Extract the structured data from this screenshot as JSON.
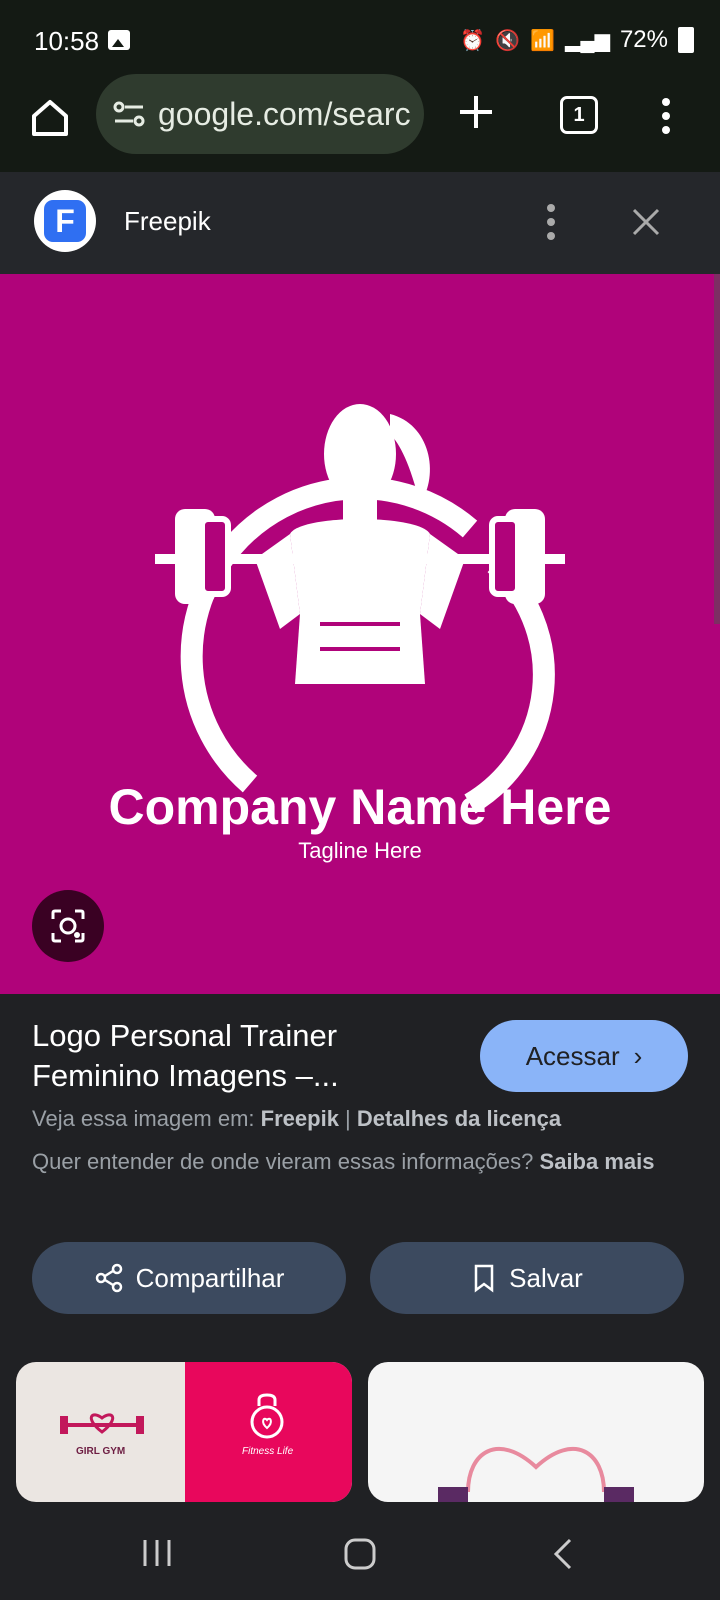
{
  "status_bar": {
    "time": "10:58",
    "battery": "72%"
  },
  "browser": {
    "url": "google.com/searc",
    "tab_count": "1"
  },
  "source": {
    "name": "Freepik",
    "logo_letter": "F"
  },
  "image": {
    "company_name": "Company Name Here",
    "tagline": "Tagline Here"
  },
  "result": {
    "title": "Logo Personal Trainer Feminino Imagens –...",
    "open_label": "Acessar",
    "view_prefix": "Veja essa imagem em:",
    "view_source": "Freepik",
    "license_link": "Detalhes da licença",
    "question": "Quer entender de onde vieram essas informações?",
    "learn_more": "Saiba mais",
    "share_label": "Compartilhar",
    "save_label": "Salvar"
  },
  "related": {
    "thumb1_left_text": "GIRL GYM",
    "thumb1_right_text": "Fitness Life"
  }
}
